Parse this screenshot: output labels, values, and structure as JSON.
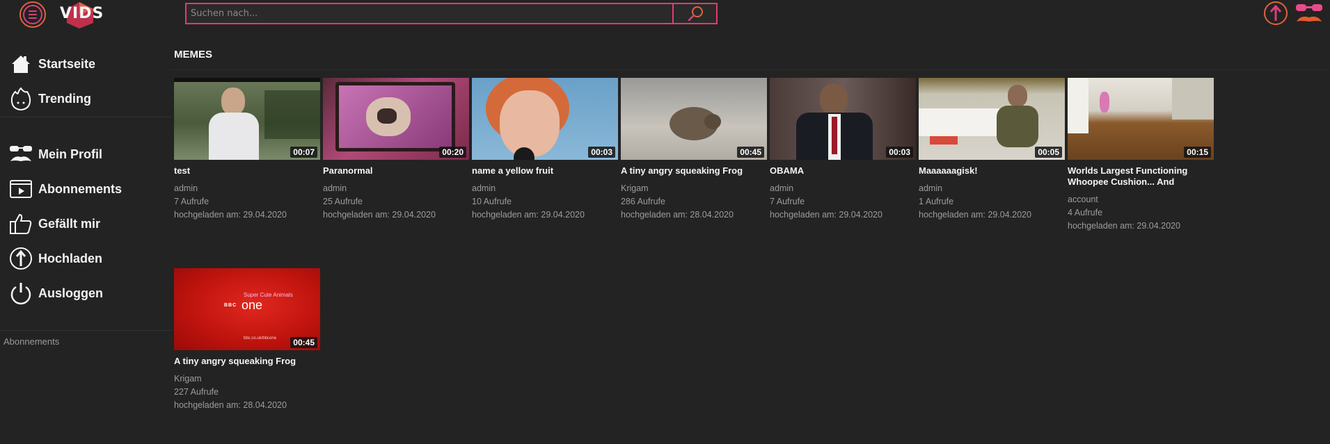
{
  "header": {
    "logo_text": "VIDS",
    "search_placeholder": "Suchen nach..."
  },
  "sidebar": {
    "items": [
      {
        "label": "Startseite",
        "icon": "home-icon"
      },
      {
        "label": "Trending",
        "icon": "flame-icon"
      },
      {
        "label": "Mein Profil",
        "icon": "mustache-glasses-icon"
      },
      {
        "label": "Abonnements",
        "icon": "subscriptions-icon"
      },
      {
        "label": "Gefällt mir",
        "icon": "thumbs-up-icon"
      },
      {
        "label": "Hochladen",
        "icon": "upload-icon"
      },
      {
        "label": "Ausloggen",
        "icon": "power-icon"
      }
    ],
    "section_label": "Abonnements"
  },
  "main": {
    "section_title": "MEMES",
    "videos": [
      {
        "title": "test",
        "channel": "admin",
        "views": "7 Aufrufe",
        "uploaded": "hochgeladen am: 29.04.2020",
        "duration": "00:07"
      },
      {
        "title": "Paranormal",
        "channel": "admin",
        "views": "25 Aufrufe",
        "uploaded": "hochgeladen am: 29.04.2020",
        "duration": "00:20"
      },
      {
        "title": "name a yellow fruit",
        "channel": "admin",
        "views": "10 Aufrufe",
        "uploaded": "hochgeladen am: 29.04.2020",
        "duration": "00:03"
      },
      {
        "title": "A tiny angry squeaking Frog",
        "channel": "Krigam",
        "views": "286 Aufrufe",
        "uploaded": "hochgeladen am: 28.04.2020",
        "duration": "00:45"
      },
      {
        "title": "OBAMA",
        "channel": "admin",
        "views": "7 Aufrufe",
        "uploaded": "hochgeladen am: 29.04.2020",
        "duration": "00:03"
      },
      {
        "title": "Maaaaaagisk!",
        "channel": "admin",
        "views": "1 Aufrufe",
        "uploaded": "hochgeladen am: 29.04.2020",
        "duration": "00:05"
      },
      {
        "title": "Worlds Largest Functioning Whoopee Cushion... And",
        "channel": "account",
        "views": "4 Aufrufe",
        "uploaded": "hochgeladen am: 29.04.2020",
        "duration": "00:15"
      },
      {
        "title": "A tiny angry squeaking Frog",
        "channel": "Krigam",
        "views": "227 Aufrufe",
        "uploaded": "hochgeladen am: 28.04.2020",
        "duration": "00:45"
      }
    ],
    "bbc_thumb": {
      "brand_top": "Super Cute Animals",
      "brand_logo": "BBC",
      "brand_channel": "one",
      "brand_url": "bbc.co.uk/bbcone"
    }
  },
  "colors": {
    "accent_pink": "#e43c6c",
    "accent_orange": "#e0643c",
    "background": "#232323"
  }
}
